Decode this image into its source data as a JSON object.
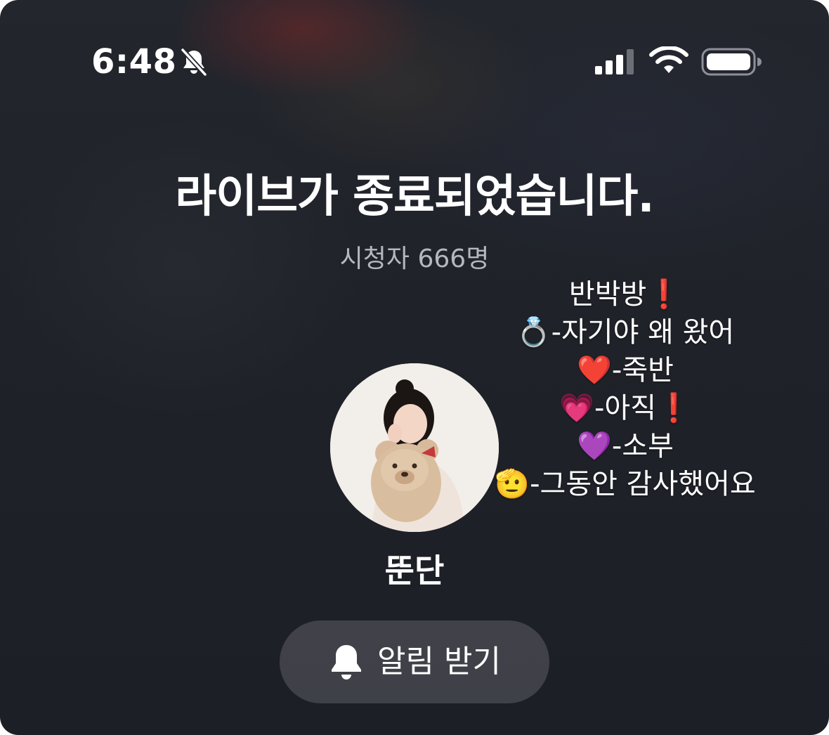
{
  "status_bar": {
    "time": "6:48",
    "icons": [
      "bell-slash-icon",
      "cellular-signal-icon",
      "wifi-icon",
      "battery-icon"
    ]
  },
  "live_ended": {
    "title": "라이브가 종료되었습니다.",
    "viewers": "시청자 666명"
  },
  "caption_overlay": {
    "lines": [
      "반박방❗",
      "💍-자기야 왜 왔어",
      "❤️-죽반",
      "💗-아직❗",
      "💜-소부",
      "🫡-그동안 감사했어요"
    ]
  },
  "streamer": {
    "name": "뚠단"
  },
  "notify_button": {
    "label": "알림 받기"
  },
  "colors": {
    "background": "#1f2229",
    "subtext": "#b5b8bf",
    "button_bg": "#4a4c52"
  }
}
